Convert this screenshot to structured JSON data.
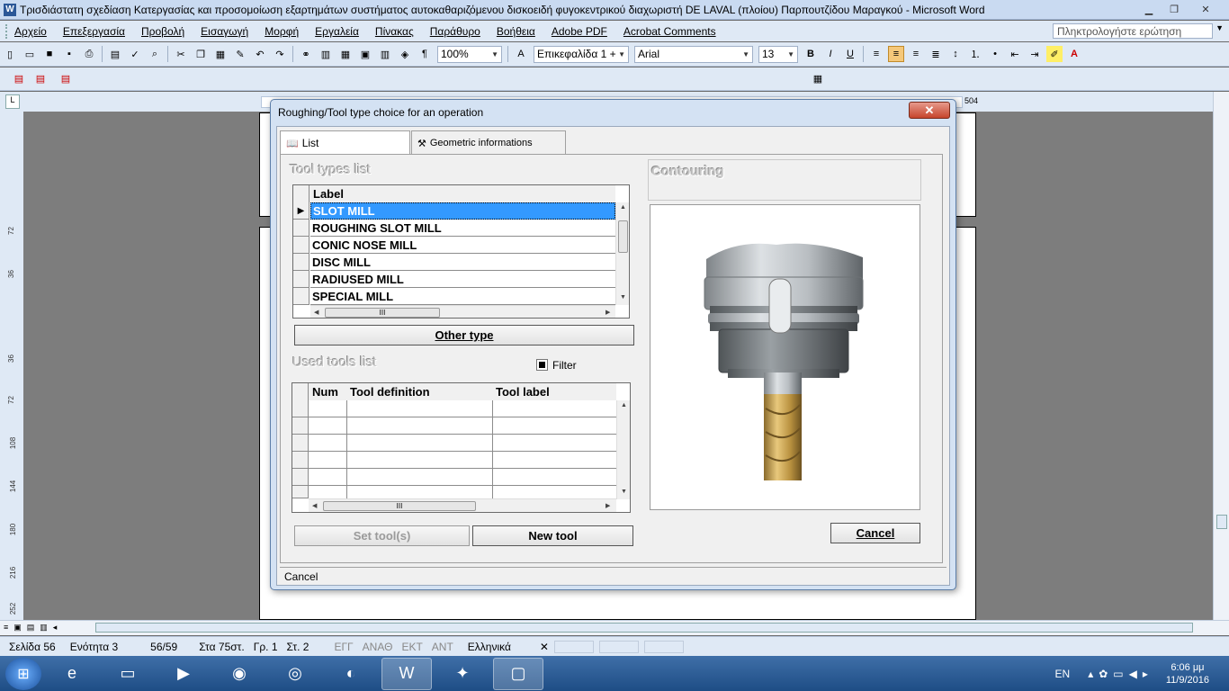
{
  "word": {
    "title": "Τρισδιάστατη σχεδίαση Κατεργασίας και προσομοίωση εξαρτημάτων συστήματος αυτοκαθαριζόμενου δισκοειδή φυγοκεντρικού διαχωριστή DE LAVAL (πλοίου) Παρπουτζίδου Μαραγκού - Microsoft Word",
    "menu": [
      "Αρχείο",
      "Επεξεργασία",
      "Προβολή",
      "Εισαγωγή",
      "Μορφή",
      "Εργαλεία",
      "Πίνακας",
      "Παράθυρο",
      "Βοήθεια",
      "Adobe PDF",
      "Acrobat Comments"
    ],
    "help_placeholder": "Πληκτρολογήστε ερώτηση",
    "zoom": "100%",
    "style": "Επικεφαλίδα 1 +",
    "font": "Arial",
    "font_size": "13",
    "ruler_marker": "504",
    "vruler_marks": [
      "72",
      "36",
      "36",
      "72",
      "108",
      "144",
      "180",
      "216",
      "252"
    ]
  },
  "status": {
    "page": "Σελίδα 56",
    "section": "Ενότητα 3",
    "pages": "56/59",
    "at": "Στα 75στ.",
    "line": "Γρ. 1",
    "col": "Στ. 2",
    "rec": "ΕΓΓ",
    "trk": "ΑΝΑΘ",
    "ext": "ΕΚΤ",
    "ovr": "ΑΝΤ",
    "language": "Ελληνικά"
  },
  "dialog": {
    "title": "Roughing/Tool type choice for an operation",
    "tabs": [
      "List",
      "Geometric informations"
    ],
    "tool_types_label": "Tool types list",
    "tool_types_header": "Label",
    "tool_types": [
      "SLOT MILL",
      "ROUGHING SLOT MILL",
      "CONIC NOSE MILL",
      "DISC MILL",
      "RADIUSED MILL",
      "SPECIAL MILL"
    ],
    "other_type_label": "Other type",
    "used_tools_label": "Used tools list",
    "filter_label": "Filter",
    "used_tools_headers": [
      "Num",
      "Tool definition",
      "Tool label"
    ],
    "operation_label": "Contouring",
    "set_tools_label": "Set tool(s)",
    "new_tool_label": "New tool",
    "cancel_label": "Cancel",
    "status_text": "Cancel"
  },
  "taskbar": {
    "lang": "EN",
    "time": "6:06 μμ",
    "date": "11/9/2016"
  }
}
